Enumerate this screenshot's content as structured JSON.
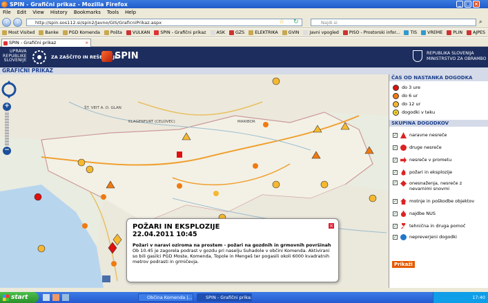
{
  "window": {
    "title": "SPIN - Grafični prikaz - Mozilla Firefox"
  },
  "menu": [
    "File",
    "Edit",
    "View",
    "History",
    "Bookmarks",
    "Tools",
    "Help"
  ],
  "nav": {
    "url": "http://spin.sos112.si/spin2/Javno/GIS/GraficniPrikaz.aspx",
    "search_placeholder": "Najdi.si"
  },
  "bookmarks": [
    "Most Visited",
    "Banke",
    "PGD Komenda",
    "Pošta",
    "VULKAN",
    "SPIN - Grafični prikaz",
    "ASK",
    "GZS",
    "ELEKTRIKA",
    "GVIN",
    "Javni vpogled",
    "PISO - Prostorski infor...",
    "TIS",
    "VREME",
    "PLIN",
    "AJPES"
  ],
  "tab": {
    "label": "SPIN - Grafični prikaz"
  },
  "site": {
    "logo_line1": "UPRAVA",
    "logo_line2": "REPUBLIKE",
    "logo_line3": "SLOVENIJE",
    "agency": "ZA ZAŠČITO IN REŠEVANJE",
    "brand": "SPIN",
    "rs_line1": "REPUBLIKA SLOVENIJA",
    "rs_line2": "MINISTRSTVO ZA OBRAMBO",
    "subheader": "GRAFIČNI PRIKAZ"
  },
  "panel": {
    "time_title": "ČAS OD NASTANKA DOGODKA",
    "time_items": [
      {
        "label": "do 3 ure",
        "color": "#e01010"
      },
      {
        "label": "do 6 ur",
        "color": "#f07a10"
      },
      {
        "label": "do 12 ur",
        "color": "#f5b830"
      },
      {
        "label": "dogodki v teku",
        "color": "#f7e03a"
      }
    ],
    "group_title": "SKUPINA DOGODKOV",
    "groups": [
      {
        "label": "naravne nesreče",
        "icon": "triangle-icon"
      },
      {
        "label": "druge nesreče",
        "icon": "circle-icon"
      },
      {
        "label": "nesreče v prometu",
        "icon": "arrow-icon"
      },
      {
        "label": "požari in eksplozije",
        "icon": "fire-icon"
      },
      {
        "label": "onesnaženja, nesreče z nevarnimi snovmi",
        "icon": "diamond-icon"
      },
      {
        "label": "motnje in poškodbe objektov",
        "icon": "house-icon"
      },
      {
        "label": "najdbe NUS",
        "icon": "bomb-icon"
      },
      {
        "label": "tehnična in druga pomoč",
        "icon": "wrench-icon"
      },
      {
        "label": "nepreverjeni dogodki",
        "icon": "question-icon"
      }
    ],
    "button": "Prikaži"
  },
  "popup": {
    "title": "POŽARI IN EKSPLOZIJE",
    "datetime": "22.04.2011 10:45",
    "lead": "Požari v naravi oziroma na prostem - požari na gozdnih in grmovnih površinah",
    "body": "Ob 10.45 je zagorela podrast v gozdu pri naselju Suhadole v občini Komenda. Aktivirani so bili gasilci PGD Moste, Komenda, Topole in Mengeš ter pogasili okoli 6000 kvadratnih metrov podrasti in grmičevja."
  },
  "map_labels": [
    "KLAGENFURT (CELOVEC)",
    "MARIBOR",
    "ŠT. VEIT A. D. GLAN"
  ],
  "taskbar": {
    "start": "start",
    "task1": "Občina Komenda |...",
    "task2": "SPIN - Grafični prikaz ...",
    "clock": "17:40"
  }
}
